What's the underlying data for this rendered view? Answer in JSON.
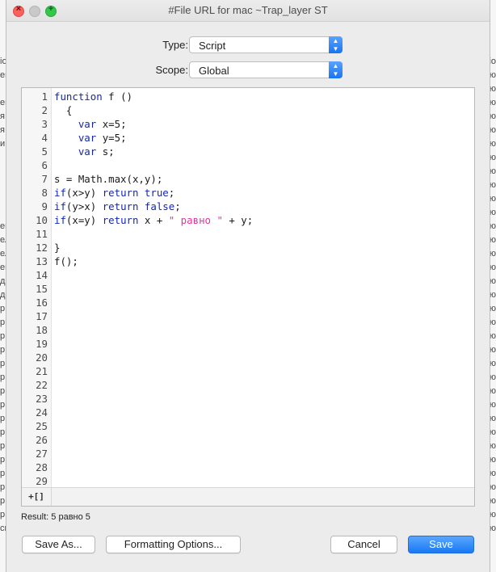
{
  "window": {
    "title": "#File URL for mac ~Trap_layer ST"
  },
  "form": {
    "type_label": "Type:",
    "type_value": "Script",
    "scope_label": "Scope:",
    "scope_value": "Global"
  },
  "editor": {
    "lines": [
      {
        "n": "1",
        "tokens": [
          {
            "t": "function",
            "c": "kw"
          },
          {
            "t": " f ()",
            "c": ""
          }
        ]
      },
      {
        "n": "2",
        "tokens": [
          {
            "t": "  {",
            "c": ""
          }
        ]
      },
      {
        "n": "3",
        "tokens": [
          {
            "t": "    ",
            "c": ""
          },
          {
            "t": "var",
            "c": "kw"
          },
          {
            "t": " x=5;",
            "c": ""
          }
        ]
      },
      {
        "n": "4",
        "tokens": [
          {
            "t": "    ",
            "c": ""
          },
          {
            "t": "var",
            "c": "kw"
          },
          {
            "t": " y=5;",
            "c": ""
          }
        ]
      },
      {
        "n": "5",
        "tokens": [
          {
            "t": "    ",
            "c": ""
          },
          {
            "t": "var",
            "c": "kw"
          },
          {
            "t": " s;",
            "c": ""
          }
        ]
      },
      {
        "n": "6",
        "tokens": []
      },
      {
        "n": "7",
        "tokens": [
          {
            "t": "s = Math.max(x,y);",
            "c": ""
          }
        ]
      },
      {
        "n": "8",
        "tokens": [
          {
            "t": "if",
            "c": "kw"
          },
          {
            "t": "(x>y) ",
            "c": ""
          },
          {
            "t": "return",
            "c": "kw"
          },
          {
            "t": " ",
            "c": ""
          },
          {
            "t": "true",
            "c": "kw"
          },
          {
            "t": ";",
            "c": ""
          }
        ]
      },
      {
        "n": "9",
        "tokens": [
          {
            "t": "if",
            "c": "kw"
          },
          {
            "t": "(y>x) ",
            "c": ""
          },
          {
            "t": "return",
            "c": "kw"
          },
          {
            "t": " ",
            "c": ""
          },
          {
            "t": "false",
            "c": "kw"
          },
          {
            "t": ";",
            "c": ""
          }
        ]
      },
      {
        "n": "10",
        "tokens": [
          {
            "t": "if",
            "c": "kw"
          },
          {
            "t": "(x=y) ",
            "c": ""
          },
          {
            "t": "return",
            "c": "kw"
          },
          {
            "t": " x + ",
            "c": ""
          },
          {
            "t": "\" равно \"",
            "c": "str"
          },
          {
            "t": " + y;",
            "c": ""
          }
        ]
      },
      {
        "n": "11",
        "tokens": []
      },
      {
        "n": "12",
        "tokens": [
          {
            "t": "}",
            "c": ""
          }
        ]
      },
      {
        "n": "13",
        "tokens": [
          {
            "t": "f();",
            "c": ""
          }
        ]
      },
      {
        "n": "14",
        "tokens": []
      },
      {
        "n": "15",
        "tokens": []
      },
      {
        "n": "16",
        "tokens": []
      },
      {
        "n": "17",
        "tokens": []
      },
      {
        "n": "18",
        "tokens": []
      },
      {
        "n": "19",
        "tokens": []
      },
      {
        "n": "20",
        "tokens": []
      },
      {
        "n": "21",
        "tokens": []
      },
      {
        "n": "22",
        "tokens": []
      },
      {
        "n": "23",
        "tokens": []
      },
      {
        "n": "24",
        "tokens": []
      },
      {
        "n": "25",
        "tokens": []
      },
      {
        "n": "26",
        "tokens": []
      },
      {
        "n": "27",
        "tokens": []
      },
      {
        "n": "28",
        "tokens": []
      },
      {
        "n": "29",
        "tokens": []
      }
    ],
    "toggle_label": "+[]"
  },
  "result": "Result: 5 равно 5",
  "buttons": {
    "save_as": "Save As...",
    "formatting": "Formatting Options...",
    "cancel": "Cancel",
    "save": "Save"
  },
  "background": {
    "left_glyphs": [
      "",
      "",
      "",
      "",
      "io",
      "ен",
      "",
      "ен",
      "я",
      "я",
      "и",
      "",
      "",
      "",
      "",
      "",
      "ен",
      "ел",
      "ел",
      "ен",
      "д",
      "де",
      "р",
      "р",
      "р",
      "р",
      "р",
      "р",
      "р",
      "р",
      "р",
      "р",
      "р",
      "р",
      "р",
      "р",
      "р",
      "р",
      "си"
    ],
    "right_glyphs": [
      "",
      "",
      "",
      "",
      "io",
      "ю",
      "ю",
      "ю",
      "ю",
      "ю",
      "ю",
      "ю",
      "ю",
      "ю",
      "ю",
      "ю",
      "ю",
      "ю",
      "ю",
      "ю",
      "ю",
      "ю",
      "ю",
      "ю",
      "ю",
      "ю",
      "ю",
      "ю",
      "ю",
      "ю",
      "ю",
      "ю",
      "ю",
      "ю",
      "ю",
      "ю",
      "ю",
      "ю",
      "ю"
    ]
  }
}
